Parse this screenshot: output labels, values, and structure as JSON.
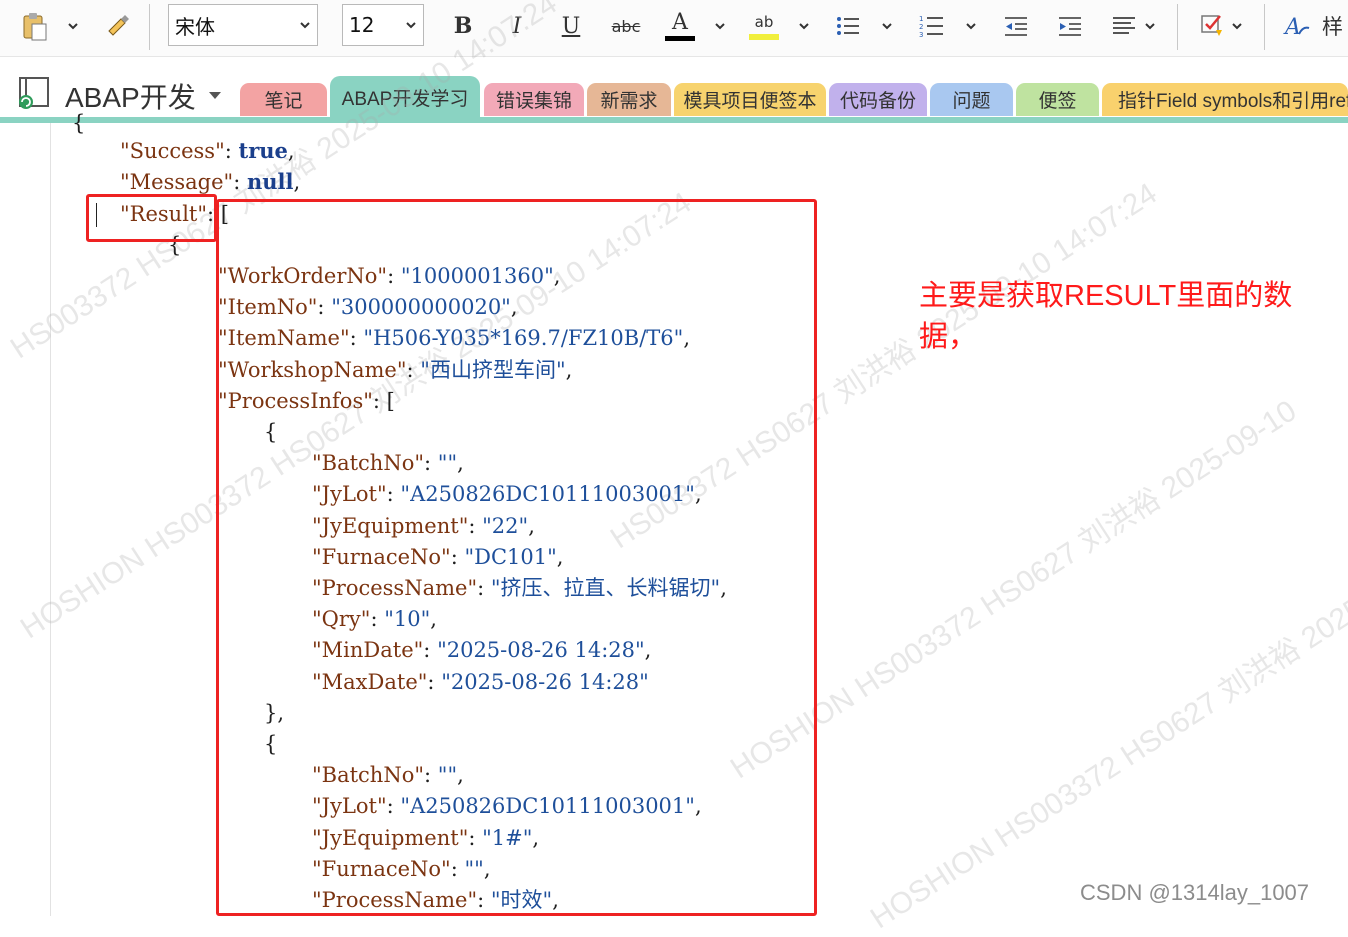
{
  "toolbar": {
    "font_name": "宋体",
    "font_size": "12",
    "bold_label": "B",
    "italic_label": "I",
    "underline_label": "U",
    "strike_label": "abc",
    "font_color_label": "A",
    "highlight_label": "ab",
    "styles_label": "样",
    "font_color": "#000000",
    "highlight_color": "#f1ef3c"
  },
  "notebook": {
    "title": "ABAP开发",
    "tabs": [
      {
        "label": "笔记",
        "color": "#f3a3a3"
      },
      {
        "label": "ABAP开发学习",
        "color": "#8ad3c2",
        "active": true
      },
      {
        "label": "错误集锦",
        "color": "#f2a9b8"
      },
      {
        "label": "新需求",
        "color": "#e6b796"
      },
      {
        "label": "模具项目便签本",
        "color": "#f7d36e"
      },
      {
        "label": "代码备份",
        "color": "#c1b1ec"
      },
      {
        "label": "问题",
        "color": "#a9c8f0"
      },
      {
        "label": "便签",
        "color": "#bfe3a0"
      },
      {
        "label": "指针Field symbols和引用ref",
        "color": "#f9d16d"
      }
    ]
  },
  "code": {
    "open_brace": "{",
    "success_key": "\"Success\"",
    "success_val": "true",
    "message_key": "\"Message\"",
    "message_val": "null",
    "result_key": "\"Result\"",
    "result_open": "[",
    "item_open": "{",
    "work_order_key": "\"WorkOrderNo\"",
    "work_order_val": "\"1000001360\"",
    "item_no_key": "\"ItemNo\"",
    "item_no_val": "\"300000000020\"",
    "item_name_key": "\"ItemName\"",
    "item_name_val": "\"H506-Y035*169.7/FZ10B/T6\"",
    "workshop_key": "\"WorkshopName\"",
    "workshop_val": "\"西山挤型车间\"",
    "process_infos_key": "\"ProcessInfos\"",
    "process_open": "[",
    "proc1": {
      "open": "{",
      "batch_key": "\"BatchNo\"",
      "batch_val": "\"\"",
      "jylot_key": "\"JyLot\"",
      "jylot_val": "\"A250826DC10111003001\"",
      "equip_key": "\"JyEquipment\"",
      "equip_val": "\"22\"",
      "furnace_key": "\"FurnaceNo\"",
      "furnace_val": "\"DC101\"",
      "pname_key": "\"ProcessName\"",
      "pname_val": "\"挤压、拉直、长料锯切\"",
      "qty_key": "\"Qry\"",
      "qty_val": "\"10\"",
      "min_key": "\"MinDate\"",
      "min_val": "\"2025-08-26 14:28\"",
      "max_key": "\"MaxDate\"",
      "max_val": "\"2025-08-26 14:28\"",
      "close": "},"
    },
    "proc2": {
      "open": "{",
      "batch_key": "\"BatchNo\"",
      "batch_val": "\"\"",
      "jylot_key": "\"JyLot\"",
      "jylot_val": "\"A250826DC10111003001\"",
      "equip_key": "\"JyEquipment\"",
      "equip_val": "\"1#\"",
      "furnace_key": "\"FurnaceNo\"",
      "furnace_val": "\"\"",
      "pname_key": "\"ProcessName\"",
      "pname_val": "\"时效\""
    }
  },
  "annotation": "主要是获取RESULT里面的数据，",
  "watermark": "CSDN @1314lay_1007",
  "diag_watermarks": [
    "HS003372 HS0627 刘洪裕 2025-09-10 14:07:24",
    "HOSHION HS003372 HS0627 刘洪裕 2025-09-10 14:07:24",
    "HS003372 HS0627 刘洪裕 2025-09-10 14:07:24",
    "HOSHION HS003372 HS0627 刘洪裕 2025-09-10",
    "HOSHION HS003372 HS0627 刘洪裕 2025-09-10 14:07:24"
  ],
  "colors": {
    "accent": "#8ad3c2",
    "annotation": "#ff1a1a",
    "box": "#ee2222"
  }
}
